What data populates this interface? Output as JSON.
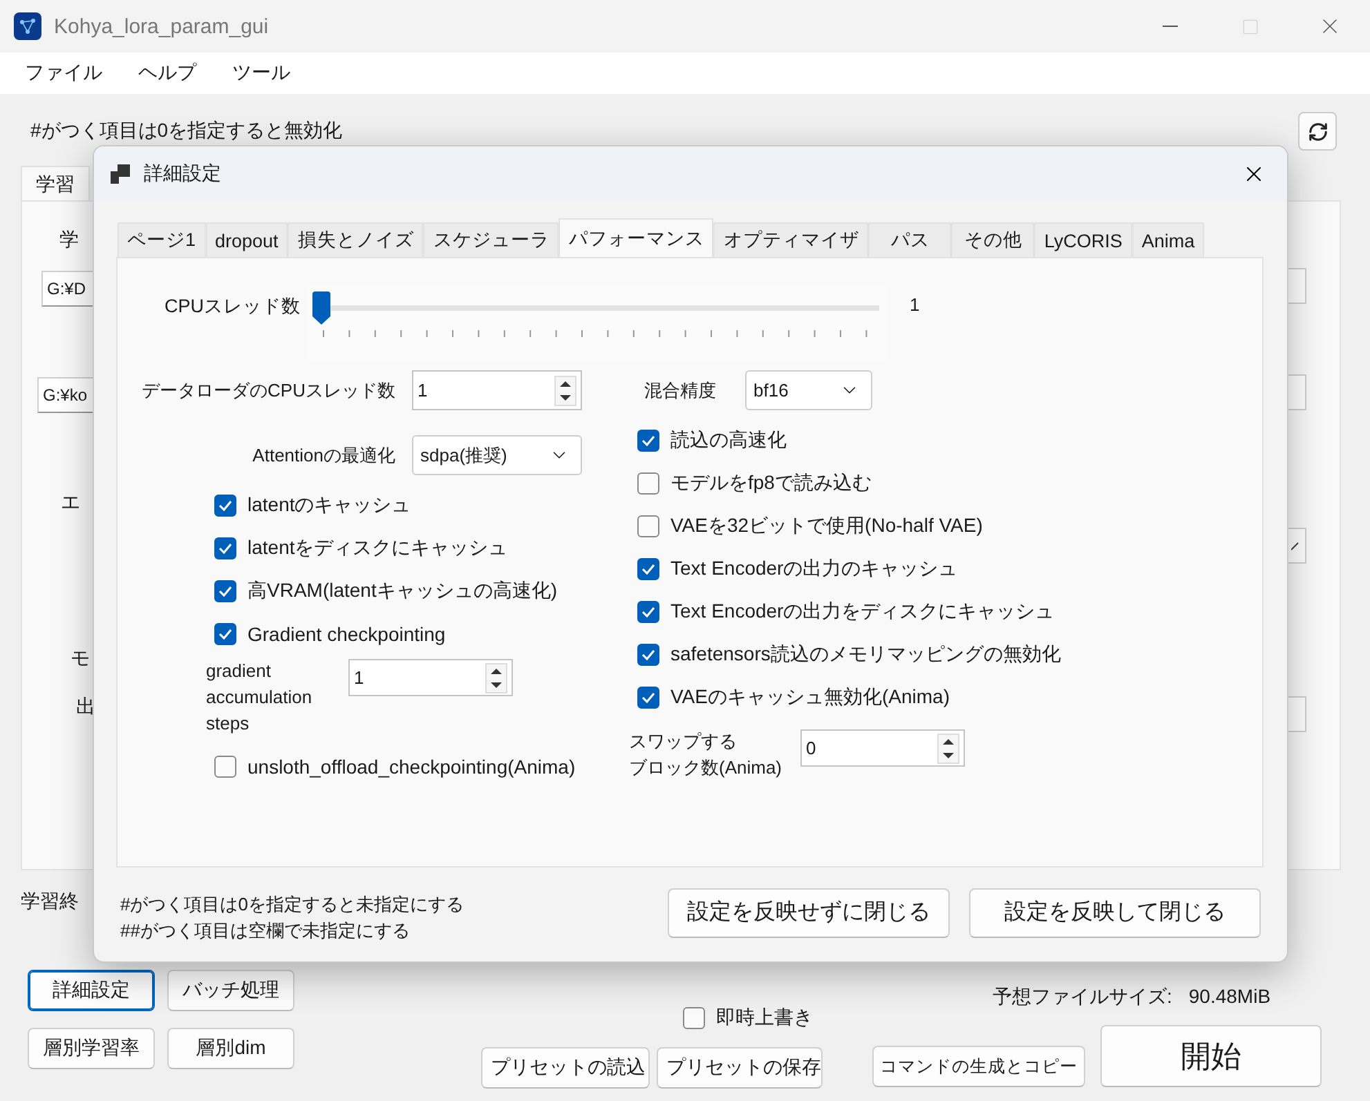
{
  "window": {
    "title": "Kohya_lora_param_gui"
  },
  "menu": [
    "ファイル",
    "ヘルプ",
    "ツール"
  ],
  "main": {
    "note": "#がつく項目は0を指定すると無効化",
    "tabs": [
      {
        "label": "学習",
        "selected": true
      }
    ],
    "left_items": [
      {
        "kind": "label",
        "text": "学"
      },
      {
        "kind": "field",
        "value": "G:¥D"
      },
      {
        "kind": "field",
        "value": "G:¥ko"
      },
      {
        "kind": "label",
        "text": "エ"
      },
      {
        "kind": "label",
        "text": "モ"
      },
      {
        "kind": "label",
        "text": "出"
      }
    ],
    "right_items": [
      {
        "kind": "field"
      },
      {
        "kind": "field"
      },
      {
        "kind": "select"
      },
      {
        "kind": "field"
      }
    ],
    "status_label": "学習終"
  },
  "bottom": {
    "left_buttons": [
      {
        "label": "詳細設定",
        "selected": true
      },
      {
        "label": "バッチ処理",
        "selected": false
      },
      {
        "label": "層別学習率",
        "selected": false
      },
      {
        "label": "層別dim",
        "selected": false
      }
    ],
    "overwrite": {
      "label": "即時上書き",
      "checked": false
    },
    "preset_buttons": [
      "プリセットの読込",
      "プリセットの保存"
    ],
    "file_size": {
      "label": "予想ファイルサイズ:",
      "value": "90.48MiB"
    },
    "command_button": "コマンドの生成とコピー",
    "start_button": "開始"
  },
  "dialog": {
    "title": "詳細設定",
    "tabs": [
      {
        "label": "ページ1",
        "selected": false
      },
      {
        "label": "dropout",
        "selected": false
      },
      {
        "label": "損失とノイズ",
        "selected": false
      },
      {
        "label": "スケジューラ",
        "selected": false
      },
      {
        "label": "パフォーマンス",
        "selected": true
      },
      {
        "label": "オプティマイザ",
        "selected": false
      },
      {
        "label": "パス",
        "selected": false
      },
      {
        "label": "その他",
        "selected": false
      },
      {
        "label": "LyCORIS",
        "selected": false
      },
      {
        "label": "Anima",
        "selected": false
      }
    ],
    "cpu_threads": {
      "label": "CPUスレッド数",
      "level": 0,
      "reading": "1"
    },
    "left": [
      {
        "kind": "spin",
        "label": "データローダのCPUスレッド数",
        "value": "1"
      },
      {
        "kind": "select",
        "label": "Attentionの最適化",
        "value": "sdpa(推奨)"
      },
      {
        "kind": "checkbox",
        "label": "latentのキャッシュ",
        "checked": true
      },
      {
        "kind": "checkbox",
        "label": "latentをディスクにキャッシュ",
        "checked": true
      },
      {
        "kind": "checkbox",
        "label": "高VRAM(latentキャッシュの高速化)",
        "checked": true
      },
      {
        "kind": "checkbox",
        "label": "Gradient checkpointing",
        "checked": true
      },
      {
        "kind": "spin",
        "label_lines": [
          "gradient",
          "accumulation",
          "steps"
        ],
        "value": "1"
      },
      {
        "kind": "checkbox",
        "label": "unsloth_offload_checkpointing(Anima)",
        "checked": false
      }
    ],
    "right": [
      {
        "kind": "select",
        "label": "混合精度",
        "value": "bf16"
      },
      {
        "kind": "checkbox",
        "label": "読込の高速化",
        "checked": true
      },
      {
        "kind": "checkbox",
        "label": "モデルをfp8で読み込む",
        "checked": false
      },
      {
        "kind": "checkbox",
        "label": "VAEを32ビットで使用(No-half VAE)",
        "checked": false
      },
      {
        "kind": "checkbox",
        "label": "Text Encoderの出力のキャッシュ",
        "checked": true
      },
      {
        "kind": "checkbox",
        "label": "Text Encoderの出力をディスクにキャッシュ",
        "checked": true
      },
      {
        "kind": "checkbox",
        "label": "safetensors読込のメモリマッピングの無効化",
        "checked": true
      },
      {
        "kind": "checkbox",
        "label": "VAEのキャッシュ無効化(Anima)",
        "checked": true
      },
      {
        "kind": "spin",
        "label_lines": [
          "スワップする",
          "ブロック数(Anima)"
        ],
        "value": "0"
      }
    ],
    "notes": [
      "#がつく項目は0を指定すると未指定にする",
      "##がつく項目は空欄で未指定にする"
    ],
    "buttons": [
      "設定を反映せずに閉じる",
      "設定を反映して閉じる"
    ]
  }
}
